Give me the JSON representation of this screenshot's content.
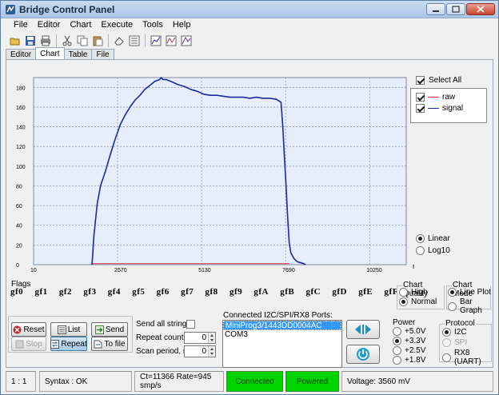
{
  "window": {
    "title": "Bridge Control Panel",
    "min_label": "–",
    "max_label": "□",
    "close_label": "✕"
  },
  "menu": [
    "File",
    "Editor",
    "Chart",
    "Execute",
    "Tools",
    "Help"
  ],
  "toolbar_icons": [
    "open-folder-icon",
    "save-icon",
    "print-icon",
    "cut-icon",
    "copy-icon",
    "paste-icon",
    "eraser-icon",
    "list-icon",
    "chart-icon",
    "chart-options-icon",
    "chart-export-icon"
  ],
  "tabs": [
    {
      "label": "Editor",
      "active": false
    },
    {
      "label": "Chart",
      "active": true
    },
    {
      "label": "Table",
      "active": false
    },
    {
      "label": "File",
      "active": false
    }
  ],
  "chart_data": {
    "type": "line",
    "x_ticks": [
      "10",
      "2570",
      "5130",
      "7690",
      "10250"
    ],
    "x_tick_values": [
      10,
      2570,
      5130,
      7690,
      10250
    ],
    "y_ticks": [
      "0",
      "20",
      "40",
      "60",
      "80",
      "100",
      "120",
      "140",
      "160",
      "180"
    ],
    "xlabel": "ms",
    "xlim": [
      10,
      11366
    ],
    "ylim": [
      0,
      190
    ],
    "grid": true,
    "legend_position": "right",
    "series": [
      {
        "name": "raw",
        "color": "#e03030",
        "x": [
          1790,
          7800
        ],
        "y": [
          1,
          1
        ]
      },
      {
        "name": "signal",
        "color": "#1a2aa0",
        "x": [
          1790,
          1800,
          1850,
          1950,
          2050,
          2200,
          2350,
          2500,
          2650,
          2800,
          2950,
          3100,
          3250,
          3400,
          3550,
          3700,
          3850,
          3900,
          3950,
          4050,
          4200,
          4400,
          4600,
          4800,
          5000,
          5200,
          5400,
          5600,
          5800,
          6000,
          6200,
          6400,
          6600,
          6800,
          7000,
          7200,
          7400,
          7550,
          7600,
          7650,
          7700,
          7750,
          7800,
          7850,
          7950,
          8050,
          8250,
          8300
        ],
        "y": [
          0,
          5,
          30,
          62,
          80,
          95,
          112,
          128,
          142,
          152,
          160,
          167,
          172,
          178,
          182,
          186,
          188,
          190,
          188,
          188,
          186,
          183,
          181,
          178,
          176,
          173,
          172,
          172,
          171,
          170,
          170,
          170,
          169,
          170,
          169,
          169,
          168,
          165,
          142,
          112,
          82,
          50,
          22,
          12,
          6,
          3,
          1,
          0
        ]
      }
    ]
  },
  "select_all": {
    "label": "Select All",
    "checked": true
  },
  "legend": [
    {
      "label": "raw",
      "color": "#e03030",
      "checked": true
    },
    {
      "label": "signal",
      "color": "#1a2aa0",
      "checked": true
    }
  ],
  "scale": {
    "options": [
      "Linear",
      "Log10"
    ],
    "selected": "Linear"
  },
  "flags": {
    "label": "Flags",
    "items": [
      "gf0",
      "gf1",
      "gf2",
      "gf3",
      "gf4",
      "gf5",
      "gf6",
      "gf7",
      "gf8",
      "gf9",
      "gfA",
      "gfB",
      "gfC",
      "gfD",
      "gfE",
      "gfF"
    ]
  },
  "chart_quality": {
    "title": "Chart Quality",
    "options": [
      "High",
      "Normal"
    ],
    "selected": "Normal"
  },
  "chart_mode": {
    "title": "Chart Mode",
    "options": [
      "Line Plot",
      "Bar Graph"
    ],
    "selected": "Line Plot"
  },
  "buttons": {
    "reset": "Reset",
    "list": "List",
    "send": "Send",
    "stop": "Stop",
    "repeat": "Repeat",
    "to_file": "To file"
  },
  "send_all": {
    "label": "Send all strings:"
  },
  "repeat_count": {
    "label": "Repeat count:",
    "value": "0"
  },
  "scan_period": {
    "label": "Scan period, ms:",
    "value": "0"
  },
  "ports": {
    "title": "Connected I2C/SPI/RX8 Ports:",
    "items": [
      "MiniProg3/1443DD0004AC",
      "COM3"
    ],
    "selected": 0
  },
  "power": {
    "title": "Power",
    "options": [
      "+5.0V",
      "+3.3V",
      "+2.5V",
      "+1.8V"
    ],
    "selected": "+3.3V"
  },
  "protocol": {
    "title": "Protocol",
    "options": [
      "I2C",
      "SPI",
      "RX8 (UART)"
    ],
    "selected": "I2C"
  },
  "status": {
    "position": "1 : 1",
    "syntax": "Syntax : OK",
    "rate": "Ct=11366 Rate=945 smp/s",
    "connected": "Connected",
    "powered": "Powered",
    "voltage": "Voltage: 3560 mV"
  }
}
